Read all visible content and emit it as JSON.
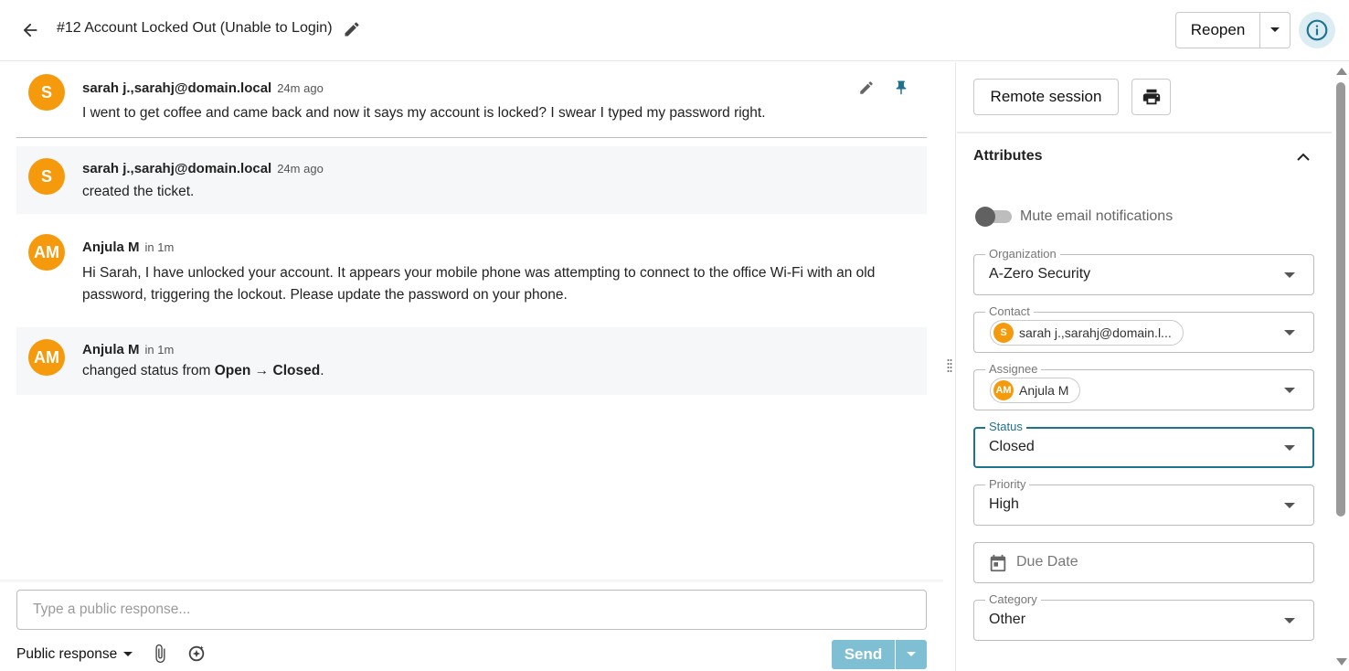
{
  "header": {
    "title": "#12 Account Locked Out (Unable to Login)",
    "reopen_label": "Reopen"
  },
  "messages": [
    {
      "avatar": "S",
      "author": "sarah j.,sarahj@domain.local",
      "time": "24m ago",
      "body": "I went to get coffee and came back and now it says my account is locked? I swear I typed my password right."
    },
    {
      "avatar": "S",
      "author": "sarah j.,sarahj@domain.local",
      "time": "24m ago",
      "body": "created the ticket."
    },
    {
      "avatar": "AM",
      "author": "Anjula M",
      "time": "in 1m",
      "body": "Hi Sarah, I have unlocked your account. It appears your mobile phone was attempting to connect to the office Wi-Fi with an old password, triggering the lockout. Please update the password on your phone."
    },
    {
      "avatar": "AM",
      "author": "Anjula M",
      "time": "in 1m",
      "body_prefix": "changed status from ",
      "from_status": "Open",
      "arrow": " → ",
      "to_status": "Closed",
      "body_suffix": "."
    }
  ],
  "composer": {
    "placeholder": "Type a public response...",
    "response_type": "Public response",
    "send_label": "Send"
  },
  "side": {
    "remote_session_label": "Remote session",
    "attributes_title": "Attributes",
    "mute_label": "Mute email notifications",
    "fields": {
      "organization": {
        "label": "Organization",
        "value": "A-Zero Security"
      },
      "contact": {
        "label": "Contact",
        "avatar": "S",
        "value": "sarah j.,sarahj@domain.l..."
      },
      "assignee": {
        "label": "Assignee",
        "avatar": "AM",
        "value": "Anjula M"
      },
      "status": {
        "label": "Status",
        "value": "Closed"
      },
      "priority": {
        "label": "Priority",
        "value": "High"
      },
      "due_date": {
        "placeholder": "Due Date"
      },
      "category": {
        "label": "Category",
        "value": "Other"
      }
    }
  },
  "colors": {
    "avatar": "#f59a0c",
    "accent": "#1e7390",
    "send_disabled": "#7fbfd4",
    "pin": "#1e7390"
  }
}
